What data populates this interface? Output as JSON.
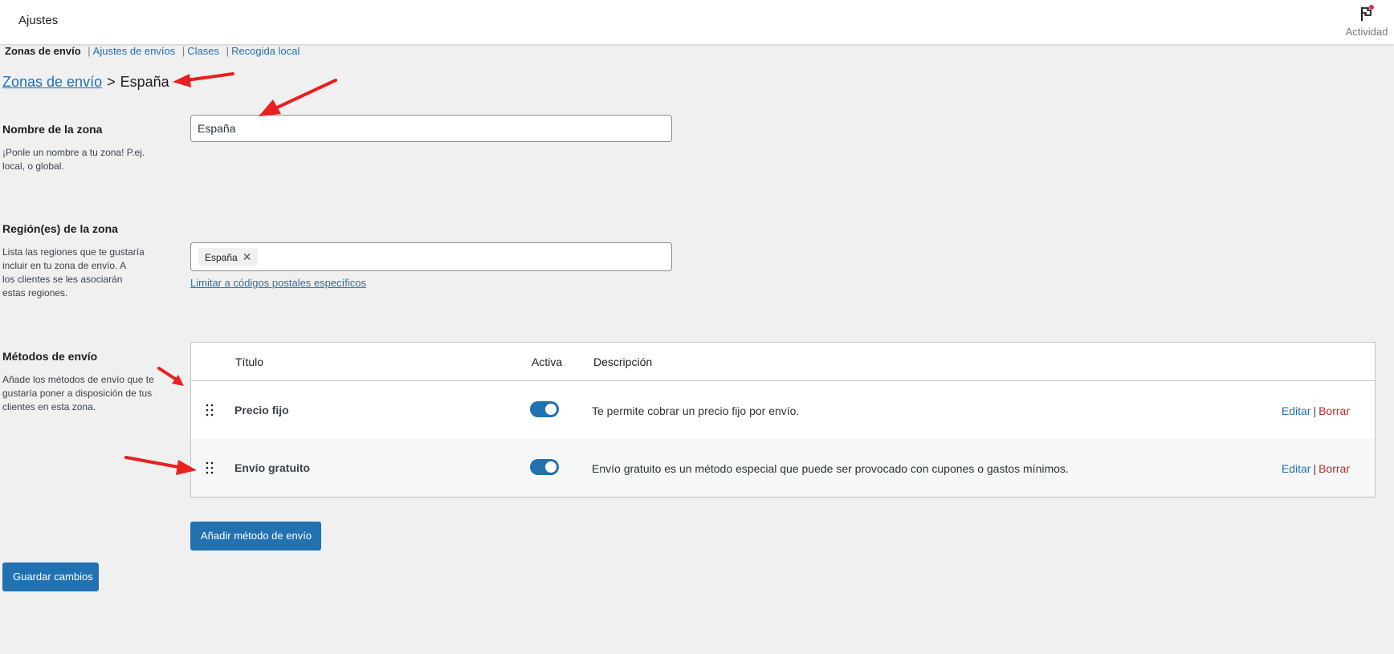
{
  "header": {
    "title": "Ajustes",
    "activity_label": "Actividad",
    "activity_icon": "flag-icon",
    "notification_color": "#d63638"
  },
  "subnav": {
    "items": [
      {
        "label": "Zonas de envío",
        "current": true
      },
      {
        "label": "Ajustes de envíos",
        "current": false
      },
      {
        "label": "Clases",
        "current": false
      },
      {
        "label": "Recogida local",
        "current": false
      }
    ],
    "separator": "|"
  },
  "breadcrumb": {
    "parent": "Zonas de envío",
    "separator": ">",
    "current": "España"
  },
  "zone_name": {
    "label": "Nombre de la zona",
    "desc_lines": [
      "¡Ponle un nombre a tu zona! P.ej.",
      "local, o global."
    ],
    "value": "España"
  },
  "zone_regions": {
    "label": "Región(es) de la zona",
    "desc_lines": [
      "Lista las regiones que te gustaría",
      "incluir en tu zona de envío. A",
      "los clientes se les asociarán",
      "estas regiones."
    ],
    "selected": [
      "España"
    ],
    "remove_icon": "close-icon",
    "postal_link": "Limitar a códigos postales específicos"
  },
  "shipping_methods": {
    "label": "Métodos de envío",
    "desc_lines": [
      "Añade los métodos de envío que te",
      "gustaría poner a disposición de tus",
      "clientes en esta zona."
    ],
    "columns": {
      "title": "Título",
      "enabled": "Activa",
      "description": "Descripción"
    },
    "rows": [
      {
        "title": "Precio fijo",
        "enabled": true,
        "description": "Te permite cobrar un precio fijo por envío.",
        "edit": "Editar",
        "delete": "Borrar"
      },
      {
        "title": "Envío gratuito",
        "enabled": true,
        "description": "Envío gratuito es un método especial que puede ser provocado con cupones o gastos mínimos.",
        "edit": "Editar",
        "delete": "Borrar"
      }
    ],
    "actions_separator": "|",
    "add_button": "Añadir método de envío"
  },
  "save_button": "Guardar cambios",
  "colors": {
    "accent": "#2271b1",
    "danger": "#b32d2e",
    "annotation_arrow": "#e8201f",
    "background": "#f0f0f1"
  }
}
